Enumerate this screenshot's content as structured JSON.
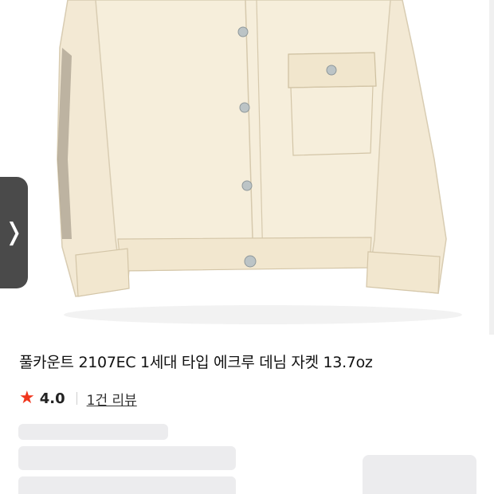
{
  "product": {
    "image_name": "ecru-denim-jacket-photo",
    "title": "풀카운트 2107EC 1세대 타입 에크루 데님 자켓 13.7oz",
    "rating": "4.0",
    "review_link": "1건 리뷰"
  },
  "carousel": {
    "prev_icon": "chevron-left-icon",
    "prev_glyph": "❭"
  },
  "colors": {
    "star": "#f0361d",
    "skeleton": "#ececee",
    "jacket": "#f5ecd8"
  }
}
